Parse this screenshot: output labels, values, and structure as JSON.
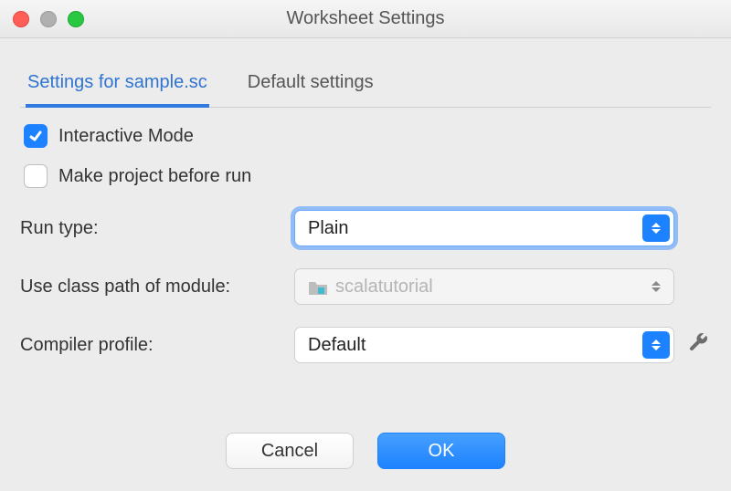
{
  "window": {
    "title": "Worksheet Settings"
  },
  "tabs": {
    "active": "Settings for sample.sc",
    "other": "Default settings"
  },
  "checks": {
    "interactive": {
      "label": "Interactive Mode",
      "checked": true
    },
    "makeBefore": {
      "label": "Make project before run",
      "checked": false
    }
  },
  "rows": {
    "runType": {
      "label": "Run type:",
      "value": "Plain",
      "focused": true,
      "disabled": false
    },
    "classpath": {
      "label": "Use class path of module:",
      "value": "scalatutorial",
      "focused": false,
      "disabled": true
    },
    "compiler": {
      "label": "Compiler profile:",
      "value": "Default",
      "focused": false,
      "disabled": false
    }
  },
  "footer": {
    "cancel": "Cancel",
    "ok": "OK"
  }
}
